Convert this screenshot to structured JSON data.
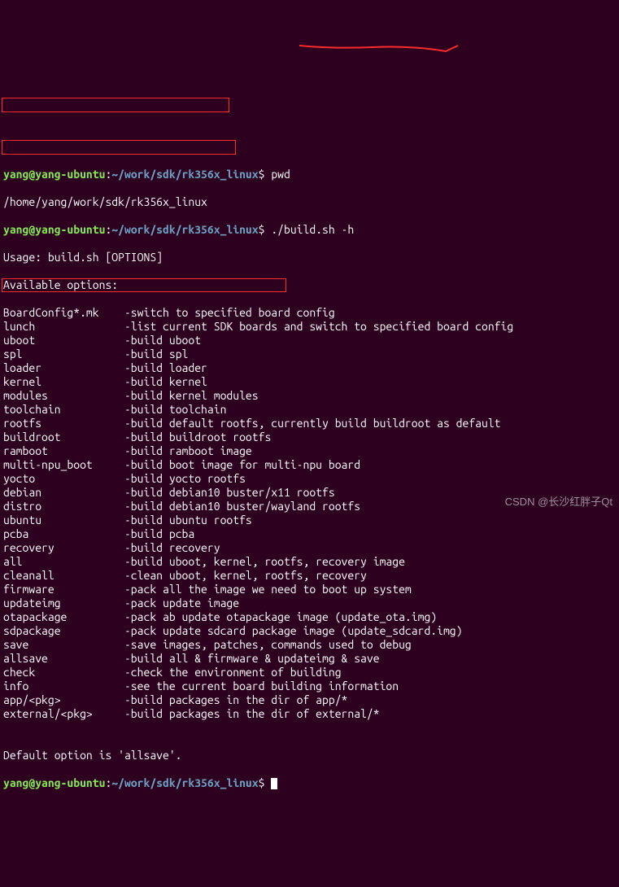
{
  "prompt1": {
    "user": "yang@yang-ubuntu",
    "sep1": ":",
    "path": "~/work/sdk/rk356x_linux",
    "sep2": "$ ",
    "cmd": "pwd"
  },
  "pwd_output": "/home/yang/work/sdk/rk356x_linux",
  "prompt2": {
    "user": "yang@yang-ubuntu",
    "sep1": ":",
    "path": "~/work/sdk/rk356x_linux",
    "sep2": "$ ",
    "cmd": "./build.sh -h"
  },
  "usage": "Usage: build.sh [OPTIONS]",
  "avail_hdr": "Available options:",
  "opts": [
    {
      "name": "BoardConfig*.mk",
      "desc": "-switch to specified board config"
    },
    {
      "name": "lunch",
      "desc": "-list current SDK boards and switch to specified board config"
    },
    {
      "name": "uboot",
      "desc": "-build uboot"
    },
    {
      "name": "spl",
      "desc": "-build spl"
    },
    {
      "name": "loader",
      "desc": "-build loader"
    },
    {
      "name": "kernel",
      "desc": "-build kernel"
    },
    {
      "name": "modules",
      "desc": "-build kernel modules"
    },
    {
      "name": "toolchain",
      "desc": "-build toolchain"
    },
    {
      "name": "rootfs",
      "desc": "-build default rootfs, currently build buildroot as default"
    },
    {
      "name": "buildroot",
      "desc": "-build buildroot rootfs"
    },
    {
      "name": "ramboot",
      "desc": "-build ramboot image"
    },
    {
      "name": "multi-npu_boot",
      "desc": "-build boot image for multi-npu board"
    },
    {
      "name": "yocto",
      "desc": "-build yocto rootfs"
    },
    {
      "name": "debian",
      "desc": "-build debian10 buster/x11 rootfs"
    },
    {
      "name": "distro",
      "desc": "-build debian10 buster/wayland rootfs"
    },
    {
      "name": "ubuntu",
      "desc": "-build ubuntu rootfs"
    },
    {
      "name": "pcba",
      "desc": "-build pcba"
    },
    {
      "name": "recovery",
      "desc": "-build recovery"
    },
    {
      "name": "all",
      "desc": "-build uboot, kernel, rootfs, recovery image"
    },
    {
      "name": "cleanall",
      "desc": "-clean uboot, kernel, rootfs, recovery"
    },
    {
      "name": "firmware",
      "desc": "-pack all the image we need to boot up system"
    },
    {
      "name": "updateimg",
      "desc": "-pack update image"
    },
    {
      "name": "otapackage",
      "desc": "-pack ab update otapackage image (update_ota.img)"
    },
    {
      "name": "sdpackage",
      "desc": "-pack update sdcard package image (update_sdcard.img)"
    },
    {
      "name": "save",
      "desc": "-save images, patches, commands used to debug"
    },
    {
      "name": "allsave",
      "desc": "-build all & firmware & updateimg & save"
    },
    {
      "name": "check",
      "desc": "-check the environment of building"
    },
    {
      "name": "info",
      "desc": "-see the current board building information"
    },
    {
      "name": "app/<pkg>",
      "desc": "-build packages in the dir of app/*"
    },
    {
      "name": "external/<pkg>",
      "desc": "-build packages in the dir of external/*"
    }
  ],
  "blank": "",
  "default_line": "Default option is 'allsave'.",
  "prompt3": {
    "user": "yang@yang-ubuntu",
    "sep1": ":",
    "path": "~/work/sdk/rk356x_linux",
    "sep2": "$ "
  },
  "watermark": "CSDN @长沙红胖子Qt"
}
